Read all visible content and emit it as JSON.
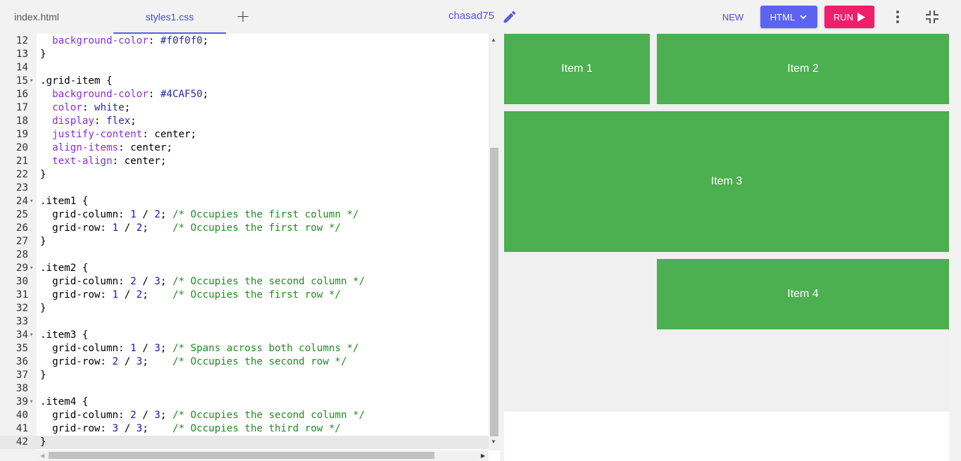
{
  "tabs": [
    {
      "label": "index.html"
    },
    {
      "label": "styles1.css"
    }
  ],
  "header": {
    "username": "chasad75",
    "new_label": "NEW",
    "html_label": "HTML",
    "run_label": "RUN"
  },
  "editor": {
    "lines": [
      {
        "n": "12",
        "fold": "",
        "segments": [
          [
            "",
            "  "
          ],
          [
            "p",
            "background-color"
          ],
          [
            "",
            ": "
          ],
          [
            "v",
            "#f0f0f0"
          ],
          [
            "",
            ";"
          ]
        ]
      },
      {
        "n": "13",
        "fold": "",
        "segments": [
          [
            "",
            "}"
          ]
        ]
      },
      {
        "n": "14",
        "fold": "",
        "segments": []
      },
      {
        "n": "15",
        "fold": "▾",
        "segments": [
          [
            "",
            ".grid-item {"
          ]
        ]
      },
      {
        "n": "16",
        "fold": "",
        "segments": [
          [
            "",
            "  "
          ],
          [
            "p",
            "background-color"
          ],
          [
            "",
            ": "
          ],
          [
            "v",
            "#4CAF50"
          ],
          [
            "",
            ";"
          ]
        ]
      },
      {
        "n": "17",
        "fold": "",
        "segments": [
          [
            "",
            "  "
          ],
          [
            "p",
            "color"
          ],
          [
            "",
            ": "
          ],
          [
            "v",
            "white"
          ],
          [
            "",
            ";"
          ]
        ]
      },
      {
        "n": "18",
        "fold": "",
        "segments": [
          [
            "",
            "  "
          ],
          [
            "p",
            "display"
          ],
          [
            "",
            ": "
          ],
          [
            "v",
            "flex"
          ],
          [
            "",
            ";"
          ]
        ]
      },
      {
        "n": "19",
        "fold": "",
        "segments": [
          [
            "",
            "  "
          ],
          [
            "p",
            "justify-content"
          ],
          [
            "",
            ": center;"
          ]
        ]
      },
      {
        "n": "20",
        "fold": "",
        "segments": [
          [
            "",
            "  "
          ],
          [
            "p",
            "align-items"
          ],
          [
            "",
            ": center;"
          ]
        ]
      },
      {
        "n": "21",
        "fold": "",
        "segments": [
          [
            "",
            "  "
          ],
          [
            "p",
            "text-align"
          ],
          [
            "",
            ": center;"
          ]
        ]
      },
      {
        "n": "22",
        "fold": "",
        "segments": [
          [
            "",
            "}"
          ]
        ]
      },
      {
        "n": "23",
        "fold": "",
        "segments": []
      },
      {
        "n": "24",
        "fold": "▾",
        "segments": [
          [
            "",
            ".item1 {"
          ]
        ]
      },
      {
        "n": "25",
        "fold": "",
        "segments": [
          [
            "",
            "  grid-column: "
          ],
          [
            "n",
            "1"
          ],
          [
            "",
            " / "
          ],
          [
            "n",
            "2"
          ],
          [
            "",
            "; "
          ],
          [
            "c",
            "/* Occupies the first column */"
          ]
        ]
      },
      {
        "n": "26",
        "fold": "",
        "segments": [
          [
            "",
            "  grid-row: "
          ],
          [
            "n",
            "1"
          ],
          [
            "",
            " / "
          ],
          [
            "n",
            "2"
          ],
          [
            "",
            ";    "
          ],
          [
            "c",
            "/* Occupies the first row */"
          ]
        ]
      },
      {
        "n": "27",
        "fold": "",
        "segments": [
          [
            "",
            "}"
          ]
        ]
      },
      {
        "n": "28",
        "fold": "",
        "segments": []
      },
      {
        "n": "29",
        "fold": "▾",
        "segments": [
          [
            "",
            ".item2 {"
          ]
        ]
      },
      {
        "n": "30",
        "fold": "",
        "segments": [
          [
            "",
            "  grid-column: "
          ],
          [
            "n",
            "2"
          ],
          [
            "",
            " / "
          ],
          [
            "n",
            "3"
          ],
          [
            "",
            "; "
          ],
          [
            "c",
            "/* Occupies the second column */"
          ]
        ]
      },
      {
        "n": "31",
        "fold": "",
        "segments": [
          [
            "",
            "  grid-row: "
          ],
          [
            "n",
            "1"
          ],
          [
            "",
            " / "
          ],
          [
            "n",
            "2"
          ],
          [
            "",
            ";    "
          ],
          [
            "c",
            "/* Occupies the first row */"
          ]
        ]
      },
      {
        "n": "32",
        "fold": "",
        "segments": [
          [
            "",
            "}"
          ]
        ]
      },
      {
        "n": "33",
        "fold": "",
        "segments": []
      },
      {
        "n": "34",
        "fold": "▾",
        "segments": [
          [
            "",
            ".item3 {"
          ]
        ]
      },
      {
        "n": "35",
        "fold": "",
        "segments": [
          [
            "",
            "  grid-column: "
          ],
          [
            "n",
            "1"
          ],
          [
            "",
            " / "
          ],
          [
            "n",
            "3"
          ],
          [
            "",
            "; "
          ],
          [
            "c",
            "/* Spans across both columns */"
          ]
        ]
      },
      {
        "n": "36",
        "fold": "",
        "segments": [
          [
            "",
            "  grid-row: "
          ],
          [
            "n",
            "2"
          ],
          [
            "",
            " / "
          ],
          [
            "n",
            "3"
          ],
          [
            "",
            ";    "
          ],
          [
            "c",
            "/* Occupies the second row */"
          ]
        ]
      },
      {
        "n": "37",
        "fold": "",
        "segments": [
          [
            "",
            "}"
          ]
        ]
      },
      {
        "n": "38",
        "fold": "",
        "segments": []
      },
      {
        "n": "39",
        "fold": "▾",
        "segments": [
          [
            "",
            ".item4 {"
          ]
        ]
      },
      {
        "n": "40",
        "fold": "",
        "segments": [
          [
            "",
            "  grid-column: "
          ],
          [
            "n",
            "2"
          ],
          [
            "",
            " / "
          ],
          [
            "n",
            "3"
          ],
          [
            "",
            "; "
          ],
          [
            "c",
            "/* Occupies the second column */"
          ]
        ]
      },
      {
        "n": "41",
        "fold": "",
        "segments": [
          [
            "",
            "  grid-row: "
          ],
          [
            "n",
            "3"
          ],
          [
            "",
            " / "
          ],
          [
            "n",
            "3"
          ],
          [
            "",
            ";    "
          ],
          [
            "c",
            "/* Occupies the third row */"
          ]
        ]
      },
      {
        "n": "42",
        "fold": "",
        "segments": [
          [
            "",
            "}"
          ]
        ],
        "active": true
      }
    ]
  },
  "preview": {
    "items": [
      "Item 1",
      "Item 2",
      "Item 3",
      "Item 4"
    ]
  },
  "icons": {
    "edit": "pencil-icon",
    "html_chevron": "chevron-down-icon",
    "run": "play-icon",
    "more": "more-vertical-icon",
    "collapse": "collapse-icon"
  }
}
